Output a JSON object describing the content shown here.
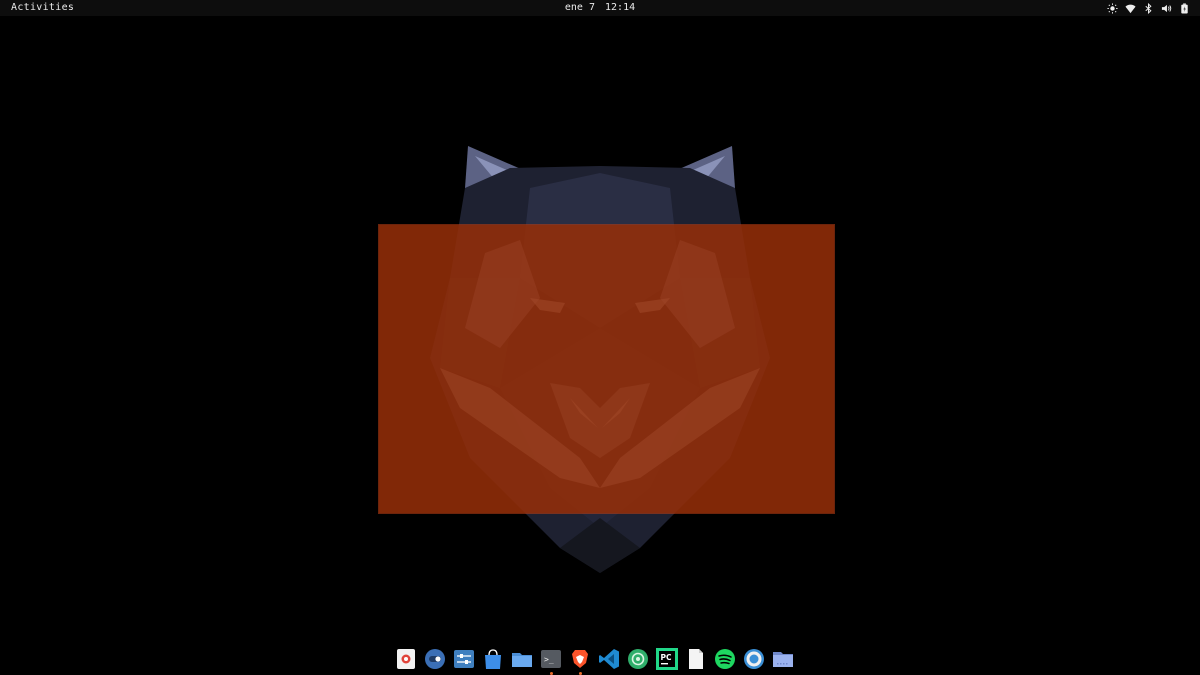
{
  "topbar": {
    "activities_label": "Activities",
    "clock": {
      "date": "ene 7",
      "time": "12:14"
    },
    "tray_icons": [
      "brightness-icon",
      "wifi-icon",
      "bluetooth-icon",
      "volume-icon",
      "battery-icon"
    ]
  },
  "desktop": {
    "wallpaper": "wolf-polygon-art",
    "selection_color": "#962e08"
  },
  "dock": {
    "items": [
      {
        "name": "photo-viewer-icon",
        "running": false
      },
      {
        "name": "toggle-app-icon",
        "running": false
      },
      {
        "name": "settings-tweaks-icon",
        "running": false
      },
      {
        "name": "software-store-icon",
        "running": false
      },
      {
        "name": "folder-icon",
        "running": false
      },
      {
        "name": "terminal-icon",
        "running": true
      },
      {
        "name": "brave-browser-icon",
        "running": true
      },
      {
        "name": "vscode-icon",
        "running": false
      },
      {
        "name": "green-app-icon",
        "running": false
      },
      {
        "name": "pycharm-icon",
        "running": false
      },
      {
        "name": "text-document-icon",
        "running": false
      },
      {
        "name": "spotify-icon",
        "running": false
      },
      {
        "name": "help-lifebuoy-icon",
        "running": false
      },
      {
        "name": "show-apps-folder-icon",
        "running": false
      }
    ],
    "pycharm_label": "PC",
    "terminal_label": ">_"
  }
}
